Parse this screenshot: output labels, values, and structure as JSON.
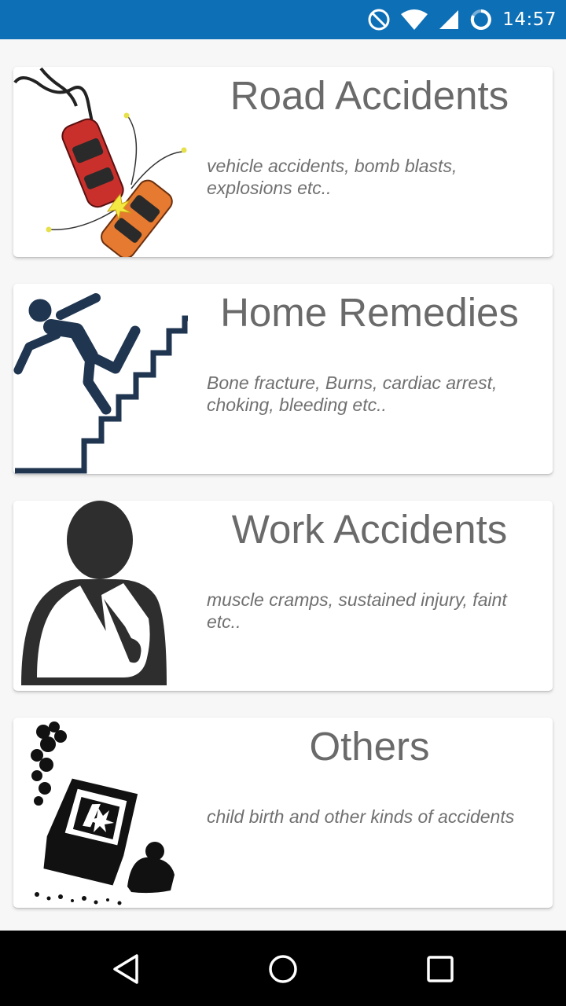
{
  "status_bar": {
    "time": "14:57",
    "icons": [
      "do-not-disturb-icon",
      "wifi-icon",
      "cell-signal-icon",
      "battery-charging-icon"
    ]
  },
  "cards": [
    {
      "title": "Road Accidents",
      "description": "vehicle accidents, bomb blasts, explosions etc..",
      "icon": "car-crash-icon"
    },
    {
      "title": "Home Remedies",
      "description": "Bone fracture, Burns, cardiac arrest, choking, bleeding etc..",
      "icon": "person-falling-stairs-icon"
    },
    {
      "title": "Work Accidents",
      "description": "muscle cramps, sustained injury, faint etc..",
      "icon": "injured-arm-sling-icon"
    },
    {
      "title": "Others",
      "description": "child birth and other kinds of accidents",
      "icon": "overturned-car-icon"
    }
  ],
  "nav_bar": {
    "buttons": [
      "back-icon",
      "home-icon",
      "recents-icon"
    ]
  },
  "colors": {
    "status_bar": "#0d6fb6",
    "title_text": "#6a6a6a",
    "desc_text": "#707070",
    "background": "#f7f7f7"
  }
}
